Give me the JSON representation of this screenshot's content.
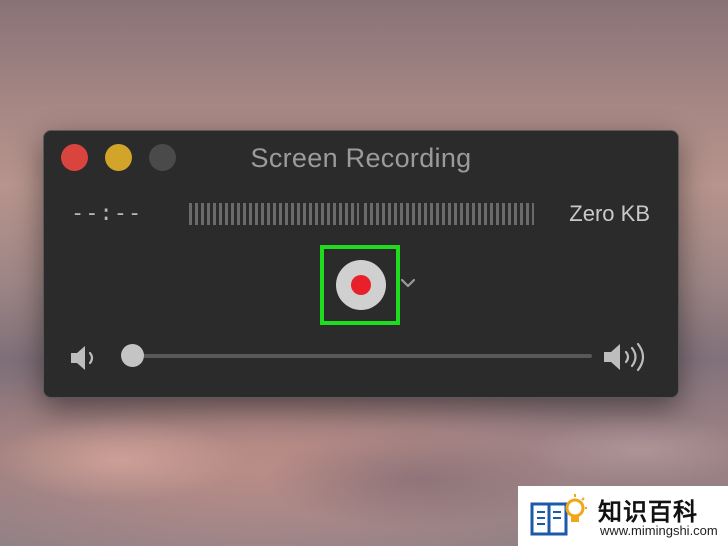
{
  "window": {
    "title": "Screen Recording"
  },
  "recording": {
    "elapsed_time": "--:--",
    "file_size": "Zero KB",
    "record_button_color": "#e8202a",
    "highlight_color": "#1fdc1f"
  },
  "volume": {
    "level": 0.0,
    "low_icon": "speaker-low-icon",
    "high_icon": "speaker-high-icon"
  },
  "watermark": {
    "name": "知识百科",
    "url": "www.mimingshi.com"
  }
}
